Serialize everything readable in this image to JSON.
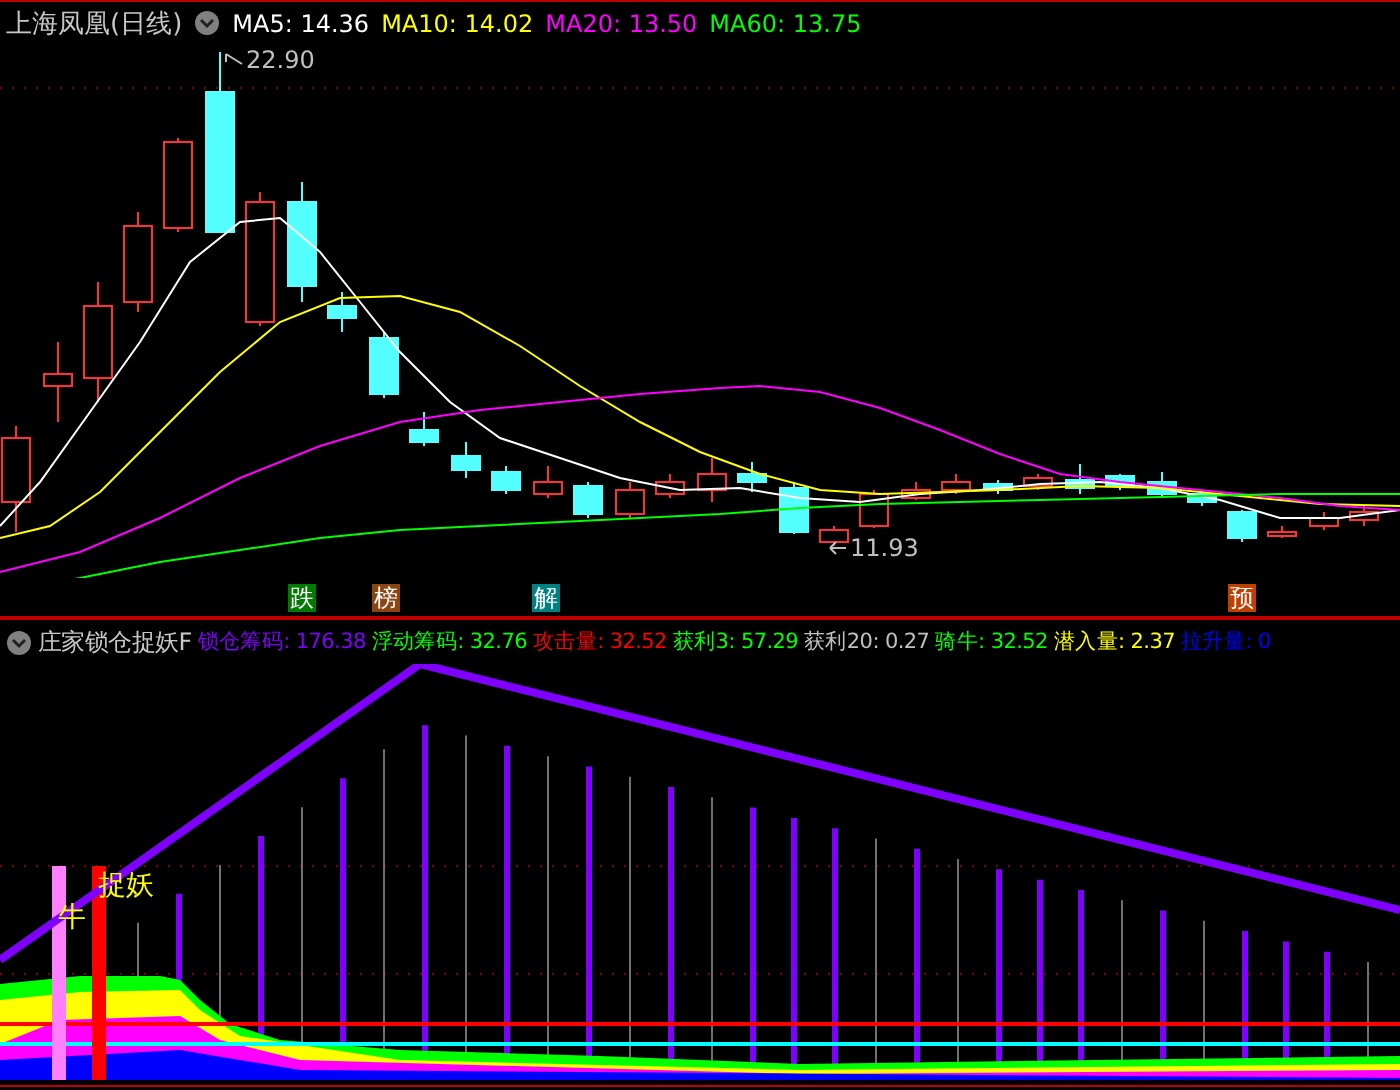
{
  "chart_header": {
    "title": "上海凤凰(日线)",
    "ma_items": [
      {
        "text": "MA5: 14.36",
        "color": "#ffffff"
      },
      {
        "text": "MA10: 14.02",
        "color": "#ffff00"
      },
      {
        "text": "MA20: 13.50",
        "color": "#ff00ff"
      },
      {
        "text": "MA60: 13.75",
        "color": "#00ff00"
      }
    ]
  },
  "price_labels": [
    {
      "text": "22.90",
      "kind": "high"
    },
    {
      "text": "11.93",
      "kind": "low"
    }
  ],
  "signal_tags": [
    {
      "text": "跌",
      "color": "#007a00"
    },
    {
      "text": "榜",
      "color": "#8b4513"
    },
    {
      "text": "解",
      "color": "#008080"
    },
    {
      "text": "预",
      "color": "#c04000"
    }
  ],
  "indicator_header": {
    "title": "庄家锁仓捉妖F",
    "items": [
      {
        "text": "锁仓筹码: 176.38",
        "color": "#8000ff"
      },
      {
        "text": "浮动筹码: 32.76",
        "color": "#00ff00"
      },
      {
        "text": "攻击量: 32.52",
        "color": "#ff0000"
      },
      {
        "text": "获利3: 57.29",
        "color": "#00ff00"
      },
      {
        "text": "获利20: 0.27",
        "color": "#c0c0c0"
      },
      {
        "text": "骑牛: 32.52",
        "color": "#00ff00"
      },
      {
        "text": "潜入量: 2.37",
        "color": "#ffff00"
      },
      {
        "text": "拉升量: 0",
        "color": "#0000ff"
      }
    ]
  },
  "indicator_labels": [
    {
      "text": "牛",
      "kind": "bull"
    },
    {
      "text": "捉妖",
      "kind": "demon"
    }
  ]
}
